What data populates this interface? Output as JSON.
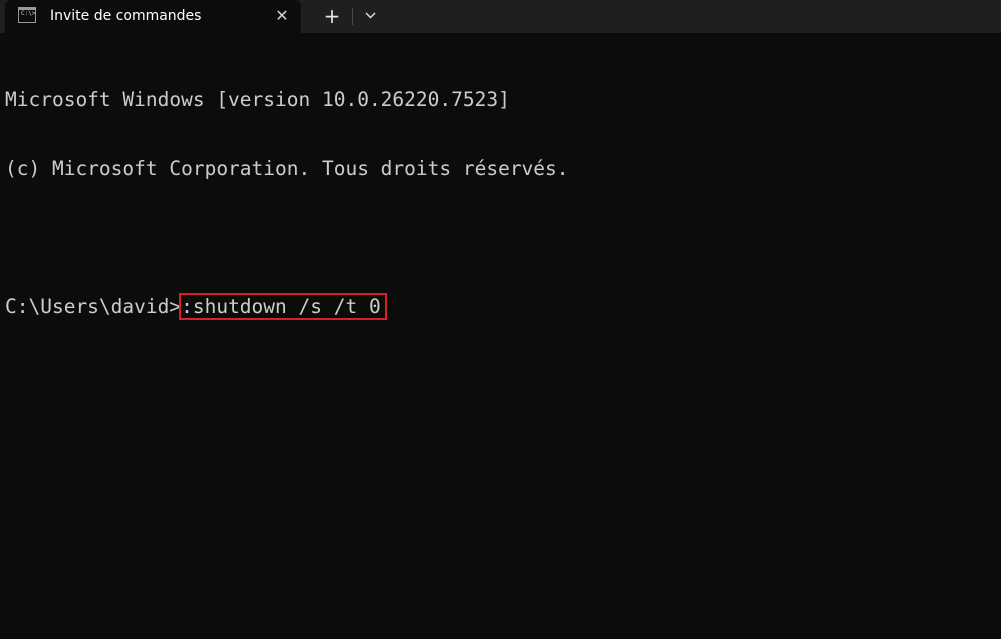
{
  "tab": {
    "title": "Invite de commandes",
    "icon": "cmd-terminal-icon",
    "icon_prompt": "C:\\>",
    "close_glyph": "✕"
  },
  "toolbar": {
    "new_tab_glyph": "+",
    "dropdown_icon": "chevron-down-icon"
  },
  "console": {
    "banner_line1": "Microsoft Windows [version 10.0.26220.7523]",
    "banner_line2": "(c) Microsoft Corporation. Tous droits réservés.",
    "prompt": "C:\\Users\\david>",
    "command": ":shutdown /s /t 0"
  },
  "colors": {
    "background": "#0c0c0c",
    "titlebar": "#1f1f1f",
    "text": "#cccccc",
    "highlight_border": "#d9202a"
  }
}
